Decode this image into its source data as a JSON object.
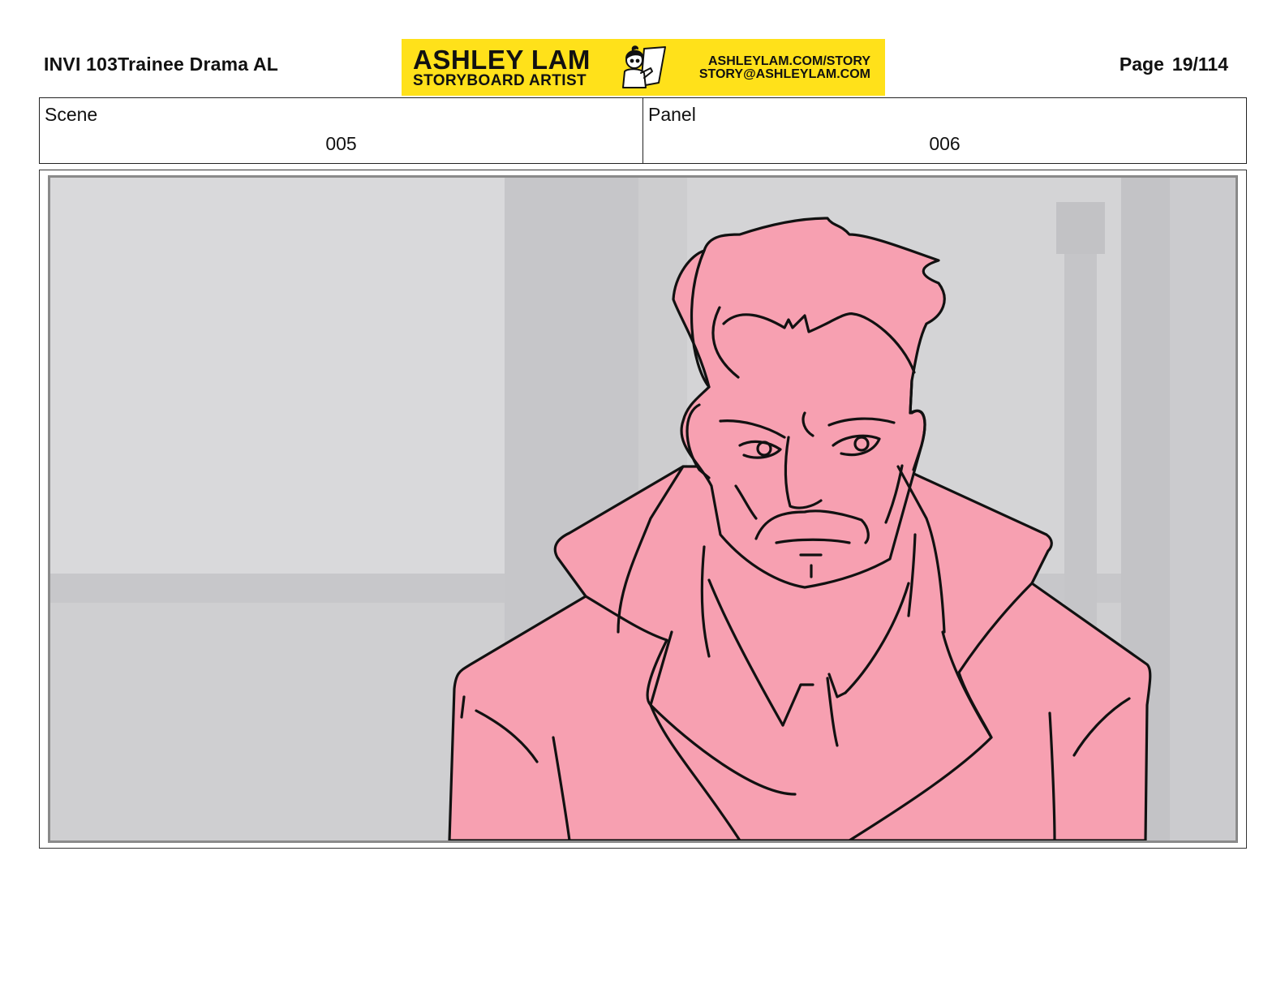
{
  "header": {
    "doc_title": "INVI 103Trainee Drama AL",
    "page_label": "Page",
    "page_number": "19/114"
  },
  "banner": {
    "name": "ASHLEY LAM",
    "role": "STORYBOARD ARTIST",
    "website": "ASHLEYLAM.COM/STORY",
    "email": "STORY@ASHLEYLAM.COM",
    "background_color": "#ffe11a"
  },
  "scene": {
    "label": "Scene",
    "value": "005"
  },
  "panel": {
    "label": "Panel",
    "value": "006"
  },
  "frame": {
    "character_fill_color": "#f7a0b1",
    "background_color": "#d3d3d5"
  }
}
